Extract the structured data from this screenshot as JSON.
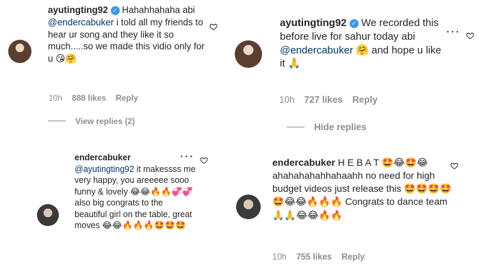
{
  "left_panel": {
    "comment": {
      "username": "ayutingting92",
      "text_before_mention": " Hahahhahaha abi ",
      "mention": "@endercabuker",
      "text_after_mention": " i told all my friends to hear ur song and they like it so much.....so we made this vidio only for u ",
      "emojis": "😘🤗",
      "time": "10h",
      "likes": "888 likes",
      "reply_label": "Reply",
      "view_replies": "View replies (2)"
    },
    "reply": {
      "username": "endercabuker",
      "dots": "• • •",
      "mention": "@ayutingting92",
      "text_after_mention": " it makessss me very happy, you areeeee sooo funny & lovely ",
      "emojis_1": "😂😂🔥🔥💞💞",
      "text_2": " also big congrats to the beautiful girl on the table, great moves ",
      "emojis_2": "😂😂🔥🔥🔥🤩🤩🤩"
    }
  },
  "right_panel": {
    "comment": {
      "username": "ayutingting92",
      "text_before_mention": " We recorded this before live for sahur today abi ",
      "mention": "@endercabuker",
      "text_after_mention": " ",
      "emoji_1": "🤗",
      "text_2": " and hope u like it ",
      "emoji_2": "🙏",
      "time": "10h",
      "likes": "727 likes",
      "reply_label": "Reply",
      "hide_replies": "Hide replies",
      "dots": "• • •"
    },
    "reply": {
      "username": "endercabuker",
      "text_1": " H E B A T ",
      "emojis_1": "🤩😂🤩😂",
      "text_2": " ahahahahahhahaahh no need for high budget videos just release this ",
      "emojis_2": "🤩🤩🤩🤩🤩😂😂🔥🔥🔥",
      "text_3": " Congrats to dance team ",
      "emojis_3": "🙏🙏😂😂🔥🔥",
      "time": "10h",
      "likes": "755 likes",
      "reply_label": "Reply"
    }
  }
}
